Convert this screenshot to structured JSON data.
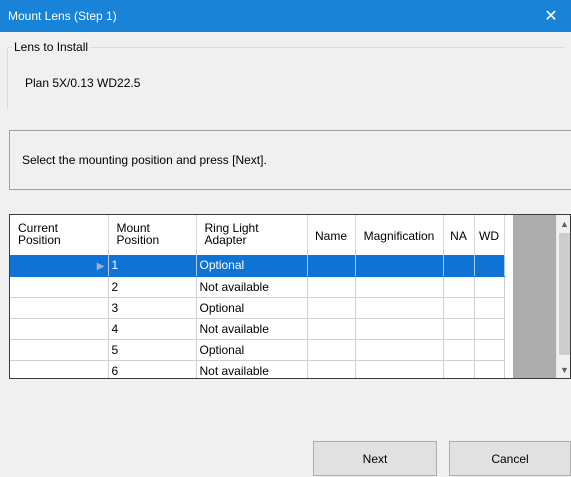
{
  "window": {
    "title": "Mount Lens (Step 1)",
    "close_glyph": "✕"
  },
  "lens_group": {
    "label": "Lens to Install",
    "lens_name": "Plan 5X/0.13 WD22.5"
  },
  "instruction": "Select the mounting position and press [Next].",
  "grid": {
    "headers": {
      "current_position": "Current Position",
      "mount_position": "Mount Position",
      "ring_light_adapter": "Ring Light Adapter",
      "name": "Name",
      "magnification": "Magnification",
      "na": "NA",
      "wd": "WD"
    },
    "current_marker": "▶",
    "rows": [
      {
        "mount": "1",
        "ring_light": "Optional",
        "name": "",
        "magnification": "",
        "na": "",
        "wd": "",
        "selected": true
      },
      {
        "mount": "2",
        "ring_light": "Not available",
        "name": "",
        "magnification": "",
        "na": "",
        "wd": ""
      },
      {
        "mount": "3",
        "ring_light": "Optional",
        "name": "",
        "magnification": "",
        "na": "",
        "wd": ""
      },
      {
        "mount": "4",
        "ring_light": "Not available",
        "name": "",
        "magnification": "",
        "na": "",
        "wd": ""
      },
      {
        "mount": "5",
        "ring_light": "Optional",
        "name": "",
        "magnification": "",
        "na": "",
        "wd": ""
      },
      {
        "mount": "6",
        "ring_light": "Not available",
        "name": "",
        "magnification": "",
        "na": "",
        "wd": ""
      }
    ],
    "scroll_up_glyph": "▲",
    "scroll_down_glyph": "▼"
  },
  "buttons": {
    "next": "Next",
    "cancel": "Cancel"
  },
  "colors": {
    "titlebar": "#1883d7",
    "selection": "#0f73d6"
  }
}
